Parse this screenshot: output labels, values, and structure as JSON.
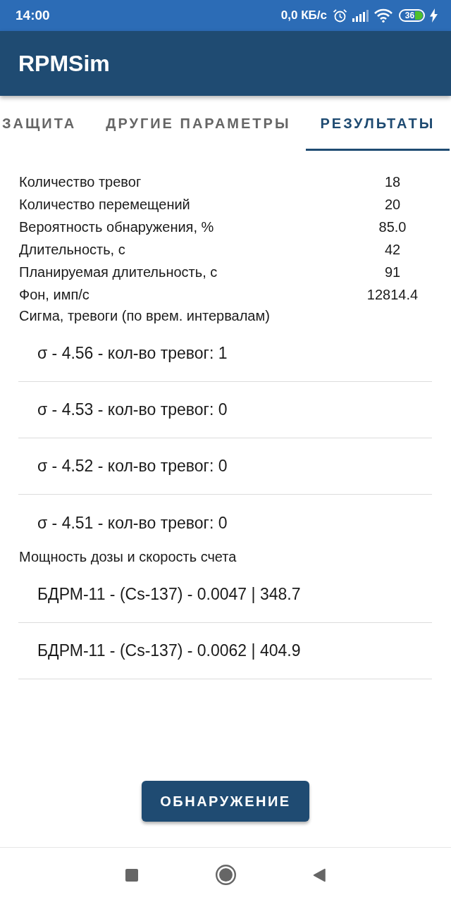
{
  "status_bar": {
    "time": "14:00",
    "network_speed": "0,0 КБ/с",
    "battery": "36"
  },
  "app_bar": {
    "title": "RPMSim"
  },
  "tabs": [
    {
      "label": "ЗАЩИТА",
      "selected": false
    },
    {
      "label": "ДРУГИЕ ПАРАМЕТРЫ",
      "selected": false
    },
    {
      "label": "РЕЗУЛЬТАТЫ",
      "selected": true
    }
  ],
  "summary": [
    {
      "label": "Количество тревог",
      "value": "18"
    },
    {
      "label": "Количество перемещений",
      "value": "20"
    },
    {
      "label": "Вероятность обнаружения, %",
      "value": "85.0"
    },
    {
      "label": "Длительность, с",
      "value": "42"
    },
    {
      "label": "Планируемая длительность, с",
      "value": "91"
    },
    {
      "label": "Фон, имп/с",
      "value": "12814.4"
    }
  ],
  "sections": [
    {
      "title": "Сигма, тревоги (по врем. интервалам)",
      "items": [
        "σ - 4.56 - кол-во тревог: 1",
        "σ - 4.53 - кол-во тревог: 0",
        "σ - 4.52 - кол-во тревог: 0",
        "σ - 4.51 - кол-во тревог: 0"
      ]
    },
    {
      "title": "Мощность дозы и скорость счета",
      "items": [
        "БДРМ-11 - (Cs-137) - 0.0047 | 348.7",
        "БДРМ-11 - (Cs-137) - 0.0062 | 404.9"
      ]
    }
  ],
  "button": {
    "label": "ОБНАРУЖЕНИЕ"
  }
}
